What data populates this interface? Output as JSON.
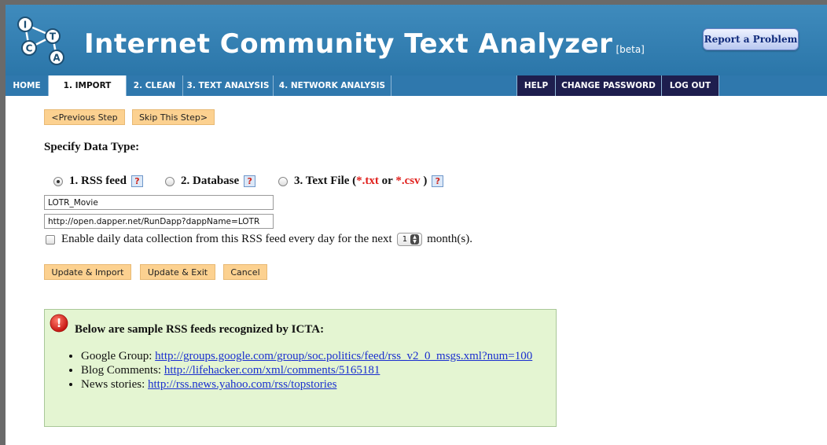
{
  "app": {
    "title": "Internet Community Text Analyzer",
    "beta": "[beta]",
    "logo_letters": [
      "I",
      "C",
      "T",
      "A"
    ],
    "report_button": "Report a Problem"
  },
  "nav": {
    "tabs": [
      {
        "label": "HOME",
        "active": false
      },
      {
        "label": "1. IMPORT",
        "active": true
      },
      {
        "label": "2. CLEAN",
        "active": false
      },
      {
        "label": "3. TEXT ANALYSIS",
        "active": false
      },
      {
        "label": "4. NETWORK ANALYSIS",
        "active": false
      }
    ],
    "right_tabs": [
      "HELP",
      "CHANGE PASSWORD",
      "LOG OUT"
    ]
  },
  "steps": {
    "previous": "<Previous Step",
    "skip": "Skip This Step>"
  },
  "form": {
    "heading": "Specify Data Type:",
    "options": [
      {
        "label": "1. RSS feed",
        "selected": true
      },
      {
        "label": "2. Database",
        "selected": false
      },
      {
        "label_prefix": "3. Text File (",
        "ext1": "*.txt",
        "or": " or ",
        "ext2": "*.csv",
        "label_suffix": " )",
        "selected": false
      }
    ],
    "help_glyph": "?",
    "name_value": "LOTR_Movie",
    "url_value": "http://open.dapper.net/RunDapp?dappName=LOTR",
    "daily_prefix": "Enable daily data collection from this RSS feed every day for the next",
    "month_value": "1",
    "daily_suffix": "month(s).",
    "buttons": {
      "update_import": "Update & Import",
      "update_exit": "Update & Exit",
      "cancel": "Cancel"
    }
  },
  "info": {
    "title": "Below are sample RSS feeds recognized by ICTA:",
    "icon_glyph": "!",
    "items": [
      {
        "prefix": "Google Group: ",
        "link": "http://groups.google.com/group/soc.politics/feed/rss_v2_0_msgs.xml?num=100"
      },
      {
        "prefix": "Blog Comments: ",
        "link": "http://lifehacker.com/xml/comments/5165181"
      },
      {
        "prefix": "News stories: ",
        "link": "http://rss.news.yahoo.com/rss/topstories"
      }
    ]
  },
  "colors": {
    "header_blue": "#3f8bbd",
    "nav_blue": "#2f78ad",
    "nav_dark": "#1e1e4e",
    "step_button": "#fcd190",
    "info_bg": "#e4f5d2",
    "link": "#1a2fcf",
    "accent_red": "#e0201c"
  }
}
